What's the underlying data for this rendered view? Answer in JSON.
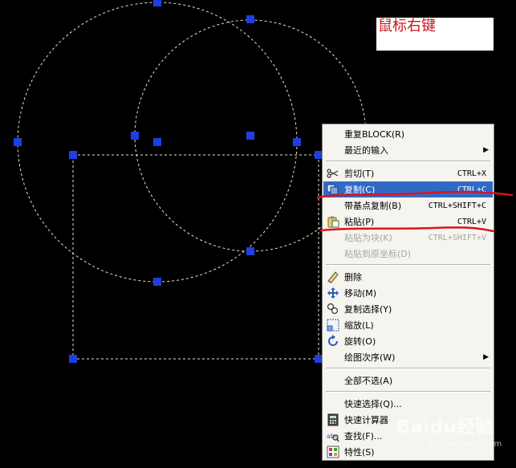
{
  "annotation": {
    "text": "鼠标右键"
  },
  "menu": {
    "items": [
      {
        "label": "重复BLOCK(R)",
        "shortcut": "",
        "icon": "",
        "state": "normal",
        "submenu": false
      },
      {
        "label": "最近的输入",
        "shortcut": "",
        "icon": "",
        "state": "normal",
        "submenu": true
      },
      {
        "label": "剪切(T)",
        "shortcut": "CTRL+X",
        "icon": "scissors-icon",
        "state": "normal",
        "submenu": false
      },
      {
        "label": "复制(C)",
        "shortcut": "CTRL+C",
        "icon": "copy-icon",
        "state": "highlighted",
        "submenu": false
      },
      {
        "label": "带基点复制(B)",
        "shortcut": "CTRL+SHIFT+C",
        "icon": "",
        "state": "normal",
        "submenu": false
      },
      {
        "label": "粘贴(P)",
        "shortcut": "CTRL+V",
        "icon": "paste-icon",
        "state": "normal",
        "submenu": false
      },
      {
        "label": "粘贴为块(K)",
        "shortcut": "CTRL+SHIFT+V",
        "icon": "",
        "state": "disabled",
        "submenu": false
      },
      {
        "label": "粘贴到原坐标(D)",
        "shortcut": "",
        "icon": "",
        "state": "disabled",
        "submenu": false
      },
      {
        "label": "删除",
        "shortcut": "",
        "icon": "eraser-icon",
        "state": "normal",
        "submenu": false
      },
      {
        "label": "移动(M)",
        "shortcut": "",
        "icon": "move-icon",
        "state": "normal",
        "submenu": false
      },
      {
        "label": "复制选择(Y)",
        "shortcut": "",
        "icon": "copy-select-icon",
        "state": "normal",
        "submenu": false
      },
      {
        "label": "缩放(L)",
        "shortcut": "",
        "icon": "scale-icon",
        "state": "normal",
        "submenu": false
      },
      {
        "label": "旋转(O)",
        "shortcut": "",
        "icon": "rotate-icon",
        "state": "normal",
        "submenu": false
      },
      {
        "label": "绘图次序(W)",
        "shortcut": "",
        "icon": "",
        "state": "normal",
        "submenu": true
      },
      {
        "label": "全部不选(A)",
        "shortcut": "",
        "icon": "",
        "state": "normal",
        "submenu": false
      },
      {
        "label": "快速选择(Q)...",
        "shortcut": "",
        "icon": "",
        "state": "normal",
        "submenu": false
      },
      {
        "label": "快速计算器",
        "shortcut": "",
        "icon": "calculator-icon",
        "state": "normal",
        "submenu": false
      },
      {
        "label": "查找(F)...",
        "shortcut": "",
        "icon": "find-icon",
        "state": "normal",
        "submenu": false
      },
      {
        "label": "特性(S)",
        "shortcut": "",
        "icon": "properties-icon",
        "state": "normal",
        "submenu": false
      }
    ]
  },
  "watermark": {
    "text": "Baidu经验",
    "url_text": "jingyan.baidu.com"
  },
  "colors": {
    "highlight": "#316ac5",
    "grip": "#1f3fe0",
    "underline": "#d9141c",
    "annotation": "#c8161d"
  }
}
